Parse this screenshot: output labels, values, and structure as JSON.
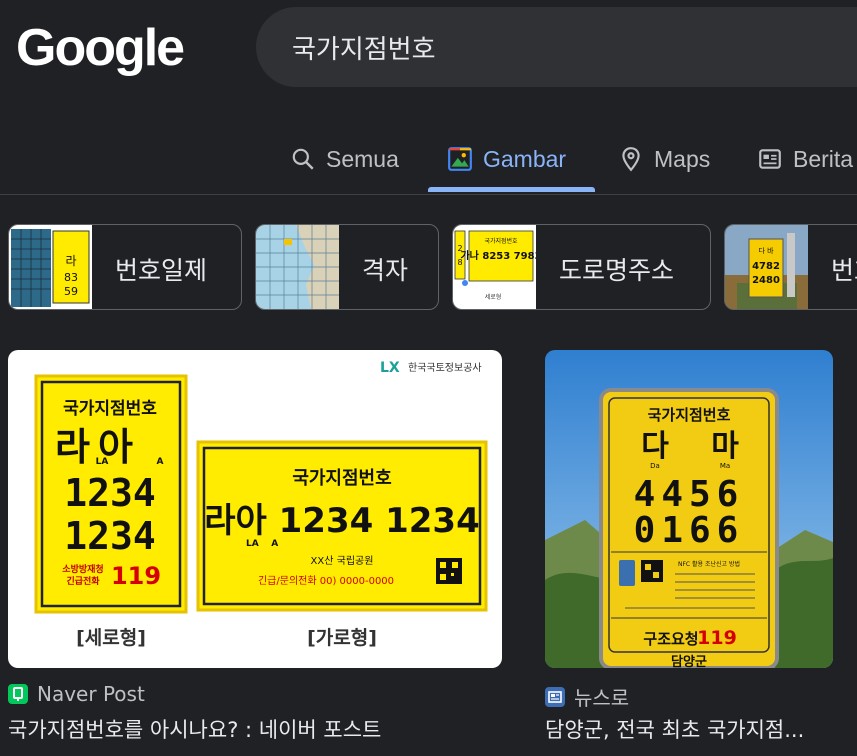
{
  "header": {
    "logo_text": "Google",
    "search_query": "국가지점번호"
  },
  "tabs": [
    {
      "label": "Semua",
      "icon": "search-icon",
      "active": false
    },
    {
      "label": "Gambar",
      "icon": "image-icon",
      "active": true
    },
    {
      "label": "Maps",
      "icon": "map-pin-icon",
      "active": false
    },
    {
      "label": "Berita",
      "icon": "news-icon",
      "active": false
    }
  ],
  "chips": [
    {
      "label": "번호일제"
    },
    {
      "label": "격자"
    },
    {
      "label": "도로명주소"
    },
    {
      "label": "번호"
    }
  ],
  "results": [
    {
      "source": "Naver Post",
      "title": "국가지점번호를 아시나요? : 네이버 포스트",
      "image": {
        "brand": "한국국토정보공사",
        "sign_title": "국가지점번호",
        "vertical_code_letters": "라아",
        "vertical_letter_sub_1": "LA",
        "vertical_letter_sub_2": "A",
        "vertical_row_1": "1234",
        "vertical_row_2": "1234",
        "vertical_footer_label_1": "소방방재청",
        "vertical_footer_label_2": "긴급전화",
        "emergency_number": "119",
        "horizontal_code": "라아 1234 1234",
        "horizontal_letter_sub": "LA    A",
        "horizontal_place": "XX산 국립공원",
        "horizontal_phone": "긴급/문의전화 00) 0000-0000",
        "caption_vertical": "[세로형]",
        "caption_horizontal": "[가로형]"
      }
    },
    {
      "source": "뉴스로",
      "title": "담양군, 전국 최초 국가지점...",
      "image": {
        "sign_title": "국가지점번호",
        "letter_1": "다",
        "letter_2": "마",
        "letter_sub_1": "Da",
        "letter_sub_2": "Ma",
        "row_1": "4456",
        "row_2": "0166",
        "nfc_text": "NFC 활용 조난신고 방법",
        "rescue_label": "구조요청",
        "rescue_number": "119",
        "county": "담양군"
      }
    }
  ]
}
